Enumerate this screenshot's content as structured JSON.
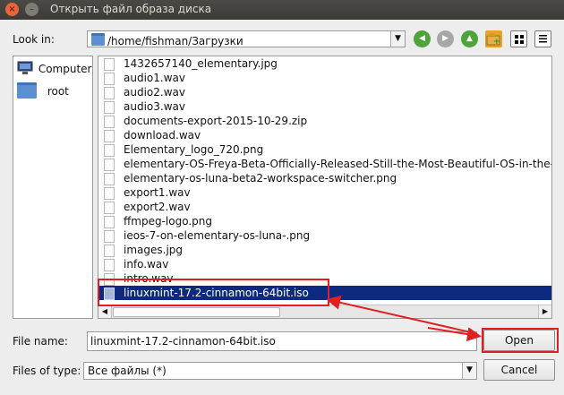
{
  "window": {
    "title": "Открыть файл образа диска",
    "close_glyph": "×",
    "minimize_glyph": "–"
  },
  "look_in": {
    "label": "Look in:",
    "path": "/home/fishman/Загрузки"
  },
  "toolbar": {
    "back": "◀",
    "forward": "▶",
    "up": "▲"
  },
  "places": [
    {
      "label": "Computer",
      "icon": "computer-icon"
    },
    {
      "label": "root",
      "icon": "folder-icon"
    }
  ],
  "files": [
    "1432657140_elementary.jpg",
    "audio1.wav",
    "audio2.wav",
    "audio3.wav",
    "documents-export-2015-10-29.zip",
    "download.wav",
    "Elementary_logo_720.png",
    "elementary-OS-Freya-Beta-Officially-Released-Still-the-Most-Beautiful-OS-in-the-",
    "elementary-os-luna-beta2-workspace-switcher.png",
    "export1.wav",
    "export2.wav",
    "ffmpeg-logo.png",
    "ieos-7-on-elementary-os-luna-.png",
    "images.jpg",
    "info.wav",
    "intro.wav",
    "linuxmint-17.2-cinnamon-64bit.iso"
  ],
  "selected_file": "linuxmint-17.2-cinnamon-64bit.iso",
  "file_name": {
    "label": "File name:",
    "value": "linuxmint-17.2-cinnamon-64bit.iso"
  },
  "file_type": {
    "label": "Files of type:",
    "value": "Все файлы (*)"
  },
  "buttons": {
    "open": "Open",
    "cancel": "Cancel"
  },
  "colors": {
    "highlight": "#e02020",
    "selection": "#0e2a80"
  }
}
